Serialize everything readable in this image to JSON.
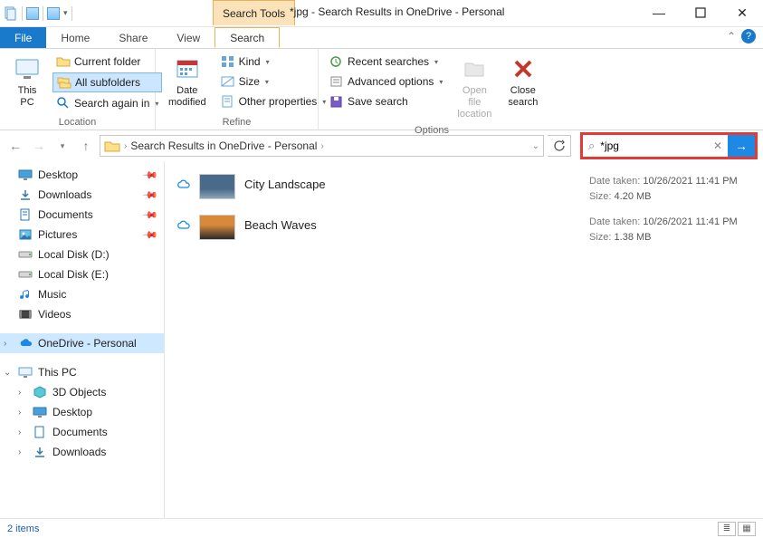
{
  "window": {
    "search_tools_label": "Search Tools",
    "title": "*jpg - Search Results in OneDrive - Personal"
  },
  "tabs": {
    "file": "File",
    "home": "Home",
    "share": "Share",
    "view": "View",
    "search": "Search"
  },
  "ribbon": {
    "location": {
      "this_pc": "This\nPC",
      "current_folder": "Current folder",
      "all_subfolders": "All subfolders",
      "search_again_in": "Search again in",
      "group_label": "Location"
    },
    "refine": {
      "date_modified": "Date\nmodified",
      "kind": "Kind",
      "size": "Size",
      "other_properties": "Other properties",
      "group_label": "Refine"
    },
    "options": {
      "recent_searches": "Recent searches",
      "advanced_options": "Advanced options",
      "save_search": "Save search",
      "open_file_location": "Open file\nlocation",
      "close_search": "Close\nsearch",
      "group_label": "Options"
    }
  },
  "address": {
    "crumb": "Search Results in OneDrive - Personal"
  },
  "search": {
    "query": "*jpg"
  },
  "nav": {
    "desktop": "Desktop",
    "downloads": "Downloads",
    "documents": "Documents",
    "pictures": "Pictures",
    "local_d": "Local Disk (D:)",
    "local_e": "Local Disk (E:)",
    "music": "Music",
    "videos": "Videos",
    "onedrive": "OneDrive - Personal",
    "this_pc": "This PC",
    "threed": "3D Objects",
    "desktop2": "Desktop",
    "documents2": "Documents",
    "downloads2": "Downloads"
  },
  "results": [
    {
      "name": "City Landscape",
      "date_label": "Date taken:",
      "date": "10/26/2021 11:41 PM",
      "size_label": "Size:",
      "size": "4.20 MB",
      "thumb_colors": [
        "#4a6a8a",
        "#8aa4b8"
      ]
    },
    {
      "name": "Beach Waves",
      "date_label": "Date taken:",
      "date": "10/26/2021 11:41 PM",
      "size_label": "Size:",
      "size": "1.38 MB",
      "thumb_colors": [
        "#d88a3a",
        "#2a2a2a"
      ]
    }
  ],
  "status": {
    "count": "2 items"
  }
}
